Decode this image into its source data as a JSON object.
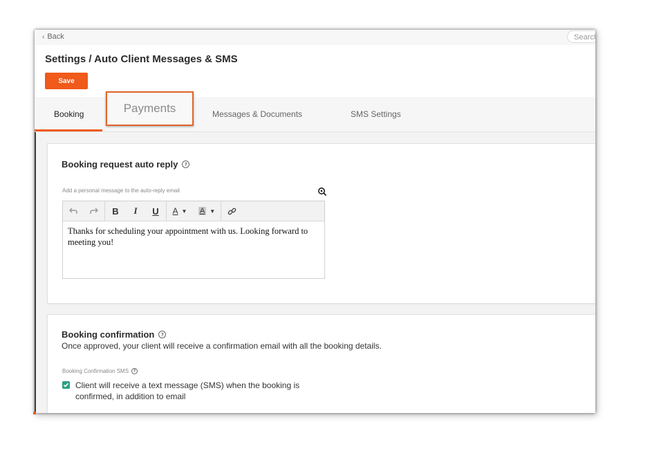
{
  "topbar": {
    "back_label": "Back",
    "search_placeholder": "Search"
  },
  "header": {
    "title": "Settings / Auto Client Messages & SMS",
    "save_label": "Save"
  },
  "tabs": [
    {
      "label": "Booking",
      "active": true
    },
    {
      "label": "Payments",
      "active": false,
      "highlighted": true
    },
    {
      "label": "Messages & Documents",
      "active": false
    },
    {
      "label": "SMS Settings",
      "active": false
    }
  ],
  "auto_reply": {
    "title": "Booking request auto reply",
    "editor_label": "Add a personal message to the auto-reply email",
    "editor_text": "Thanks for scheduling your appointment with us. Looking forward to meeting you!",
    "toolbar_icons": [
      "undo-icon",
      "redo-icon",
      "bold-icon",
      "italic-icon",
      "underline-icon",
      "text-color-icon",
      "highlight-color-icon",
      "link-icon"
    ]
  },
  "confirmation": {
    "title": "Booking confirmation",
    "description": "Once approved, your client will receive a confirmation email with all the booking details.",
    "sms_label": "Booking Confirmation SMS",
    "sms_checkbox_label": "Client will receive a text message (SMS) when the booking is confirmed, in addition to email",
    "sms_checked": true
  },
  "colors": {
    "accent": "#f05a1a",
    "checkbox": "#2aa081",
    "callout_border": "#e0662a"
  }
}
